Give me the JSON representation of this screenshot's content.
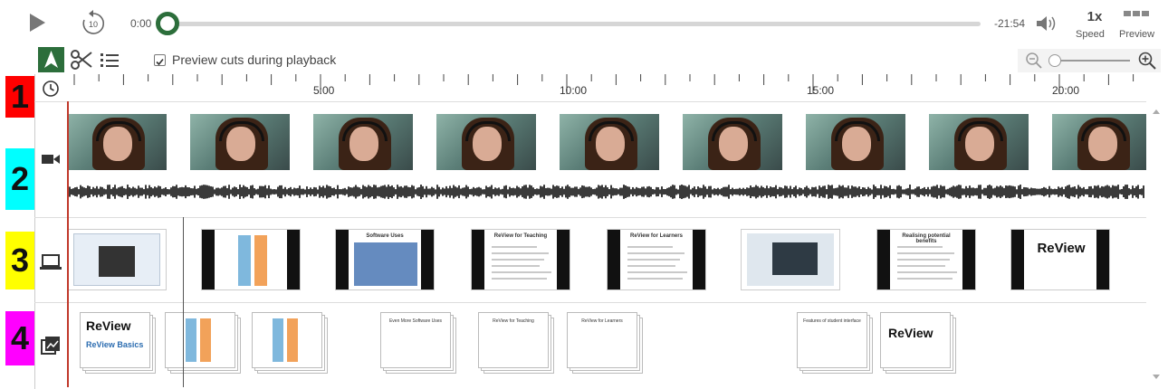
{
  "player": {
    "time_start": "0:00",
    "time_remaining": "-21:54",
    "speed_value": "1x",
    "speed_label": "Speed",
    "preview_label": "Preview",
    "rewind_seconds": "10",
    "progress_fraction": 0.0
  },
  "toolbar": {
    "preview_cuts_label": "Preview cuts during playback",
    "preview_cuts_checked": true
  },
  "ruler": {
    "labels": [
      "5:00",
      "10:00",
      "15:00",
      "20:00"
    ]
  },
  "row_numbers": [
    "1",
    "2",
    "3",
    "4"
  ],
  "row_colors": [
    "#ff0000",
    "#00ffff",
    "#ffff00",
    "#ff00ff"
  ],
  "slides": {
    "titles": [
      "",
      "",
      "Software Uses",
      "ReView for Teaching",
      "ReView for Learners",
      "",
      "Realising potential benefits",
      ""
    ]
  },
  "stacks": {
    "titles": [
      "ReView Basics",
      "",
      "",
      "Even More Software Uses",
      "ReView for Teaching",
      "ReView for Learners",
      "Features of student interface",
      ""
    ],
    "logo_text": "ReView",
    "logo_subtitle": "ReView Basics"
  },
  "icons": {
    "play": "play-icon",
    "rewind": "rewind-10-icon",
    "volume": "volume-icon",
    "preview": "preview-icon",
    "select": "select-arrow-icon",
    "cut": "scissors-icon",
    "list": "list-icon",
    "zoom_out": "zoom-out-icon",
    "zoom_in": "zoom-in-icon",
    "clock": "clock-icon",
    "camera": "camera-icon",
    "screen": "screen-icon",
    "slides": "slides-icon"
  }
}
